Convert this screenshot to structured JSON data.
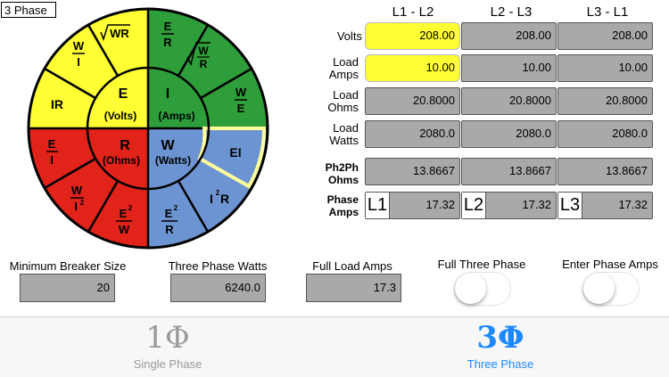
{
  "app": {
    "title": "3 Phase"
  },
  "colors": {
    "yellow": "#ffff33",
    "green": "#2e9e3a",
    "red": "#e2231a",
    "blue": "#6d94d2",
    "active_blue": "#1e88ff",
    "gray_cell": "#a9a9a9"
  },
  "wheel": {
    "center": {
      "e": {
        "letter": "E",
        "name": "(Volts)"
      },
      "i": {
        "letter": "I",
        "name": "(Amps)"
      },
      "r": {
        "letter": "R",
        "name": "(Ohms)"
      },
      "w": {
        "letter": "W",
        "name": "(Watts)"
      }
    },
    "yellow": {
      "ir": "IR",
      "w_num": "W",
      "w_den": "I",
      "sqrt_wr": "WR"
    },
    "green": {
      "e_num": "E",
      "e_den": "R",
      "sqrt_w": "W",
      "sqrt_r": "R",
      "w_num": "W",
      "w_den": "E"
    },
    "red": {
      "e_num": "E",
      "e_den": "I",
      "w_num": "W",
      "w_den": "I",
      "w_den_sup": "2",
      "e2_num": "E",
      "e2_sup": "2",
      "e2_den": "W"
    },
    "blue": {
      "ei": "EI",
      "i2r": "I",
      "i2r_sup": "2",
      "i2r_r": "R",
      "e2_num": "E",
      "e2_sup": "2",
      "e2_den": "R"
    }
  },
  "table": {
    "columns": [
      "L1 - L2",
      "L2 - L3",
      "L3 - L1"
    ],
    "rows": [
      {
        "label": "Volts",
        "values": [
          "208.00",
          "208.00",
          "208.00"
        ]
      },
      {
        "label": "Load Amps",
        "values": [
          "10.00",
          "10.00",
          "10.00"
        ]
      },
      {
        "label": "Load Ohms",
        "values": [
          "20.8000",
          "20.8000",
          "20.8000"
        ]
      },
      {
        "label": "Load Watts",
        "values": [
          "2080.0",
          "2080.0",
          "2080.0"
        ]
      },
      {
        "label": "Ph2Ph Ohms",
        "values": [
          "13.8667",
          "13.8667",
          "13.8667"
        ]
      },
      {
        "label": "Phase Amps",
        "values": [
          "17.32",
          "17.32",
          "17.32"
        ]
      }
    ],
    "phase_tags": [
      "L1",
      "L2",
      "L3"
    ]
  },
  "bottom": {
    "breaker": {
      "label": "Minimum Breaker Size",
      "value": "20"
    },
    "watts": {
      "label": "Three Phase Watts",
      "value": "6240.0"
    },
    "fla": {
      "label": "Full Load Amps",
      "value": "17.3"
    },
    "full_three_phase": {
      "label": "Full Three Phase"
    },
    "enter_phase_amps": {
      "label": "Enter Phase Amps"
    }
  },
  "tabs": [
    {
      "icon": "1Φ",
      "label": "Single Phase"
    },
    {
      "icon": "3Φ",
      "label": "Three Phase"
    }
  ]
}
